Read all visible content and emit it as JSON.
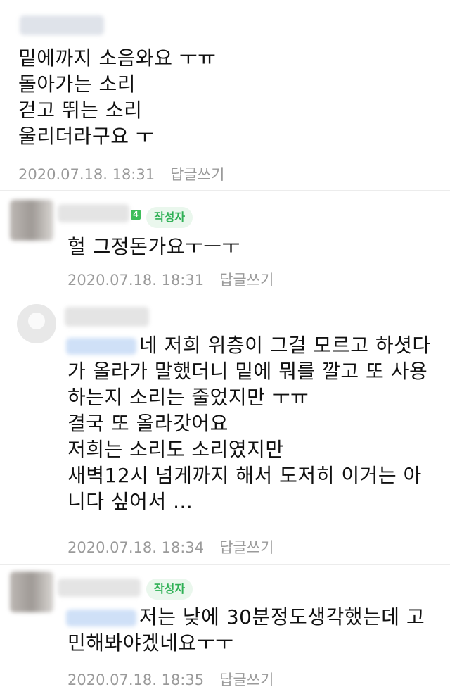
{
  "comments": [
    {
      "lines": [
        "밑에까지 소음와요 ㅜㅠ",
        "돌아가는 소리",
        "걷고 뛰는 소리",
        "울리더라구요 ㅜ"
      ],
      "date": "2020.07.18. 18:31",
      "reply": "답글쓰기"
    },
    {
      "badge": "작성자",
      "level": "4",
      "lines": [
        "헐 그정돈가요ㅜㅡㅜ"
      ],
      "date": "2020.07.18. 18:31",
      "reply": "답글쓰기"
    },
    {
      "lines": [
        "네 저희 위층이 그걸 모르고 하셧다",
        "가 올라가 말했더니 밑에 뭐를 깔고 또 사용",
        "하는지 소리는 줄었지만 ㅜㅠ",
        "결국 또 올라갓어요",
        "저희는 소리도 소리였지만",
        "새벽12시 넘게까지 해서 도저히 이거는 아",
        "니다 싶어서 ..."
      ],
      "date": "2020.07.18. 18:34",
      "reply": "답글쓰기"
    },
    {
      "badge": "작성자",
      "lines": [
        "저는 낮에 30분정도생각했는데 고",
        "민해봐야겠네요ㅜㅜ"
      ],
      "date": "2020.07.18. 18:35",
      "reply": "답글쓰기"
    }
  ]
}
